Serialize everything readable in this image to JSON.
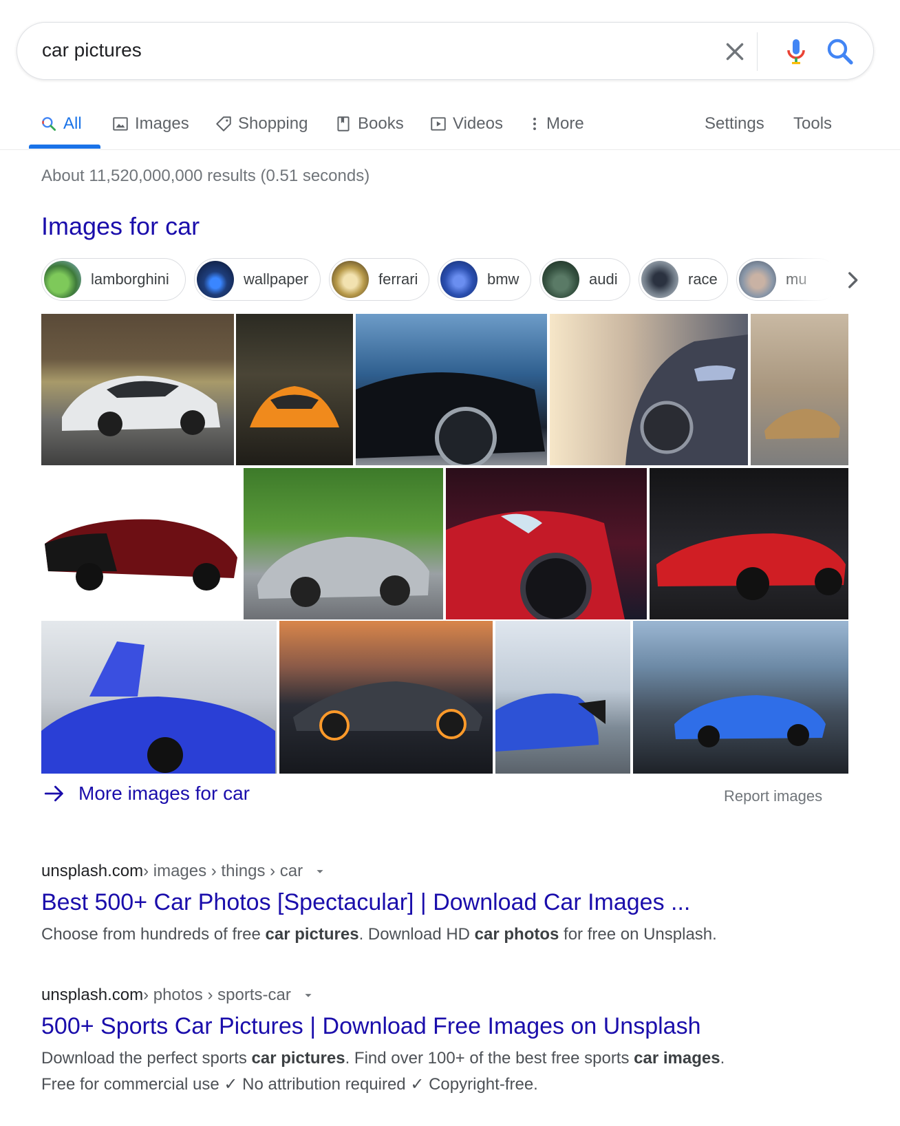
{
  "search": {
    "query": "car pictures"
  },
  "tabs": [
    {
      "label": "All",
      "icon": "search-icon",
      "active": true
    },
    {
      "label": "Images",
      "icon": "image-icon"
    },
    {
      "label": "Shopping",
      "icon": "tag-icon"
    },
    {
      "label": "Books",
      "icon": "book-icon"
    },
    {
      "label": "Videos",
      "icon": "play-icon"
    },
    {
      "label": "More",
      "icon": "more-vert-icon"
    },
    {
      "label": "Settings"
    },
    {
      "label": "Tools"
    }
  ],
  "result_stats": "About 11,520,000,000 results (0.51 seconds)",
  "images_section": {
    "heading": "Images for car",
    "chips": [
      {
        "label": "lamborghini",
        "color": "#3e7a3a"
      },
      {
        "label": "wallpaper",
        "color": "#1e3d7a"
      },
      {
        "label": "ferrari",
        "color": "#b89a4a"
      },
      {
        "label": "bmw",
        "color": "#2b4fb0"
      },
      {
        "label": "audi",
        "color": "#34503f"
      },
      {
        "label": "race",
        "color": "#6f7a86"
      },
      {
        "label": "mu",
        "color": "#8a97a8"
      }
    ],
    "more_label": "More images for car",
    "report_label": "Report images"
  },
  "results": [
    {
      "site": "unsplash.com",
      "path": " › images › things › car",
      "title": "Best 500+ Car Photos [Spectacular] | Download Car Images ...",
      "snippet": [
        {
          "text": "Choose from hundreds of free "
        },
        {
          "text": "car pictures",
          "bold": true
        },
        {
          "text": ". Download HD "
        },
        {
          "text": "car photos",
          "bold": true
        },
        {
          "text": " for free on Unsplash."
        }
      ]
    },
    {
      "site": "unsplash.com",
      "path": " › photos › sports-car",
      "title": "500+ Sports Car Pictures | Download Free Images on Unsplash",
      "snippet": [
        {
          "text": "Download the perfect sports "
        },
        {
          "text": "car pictures",
          "bold": true
        },
        {
          "text": ". Find over 100+ of the best free sports "
        },
        {
          "text": "car images",
          "bold": true
        },
        {
          "text": "."
        }
      ],
      "snippet2": "Free for commercial use ✓ No attribution required ✓ Copyright-free."
    }
  ]
}
